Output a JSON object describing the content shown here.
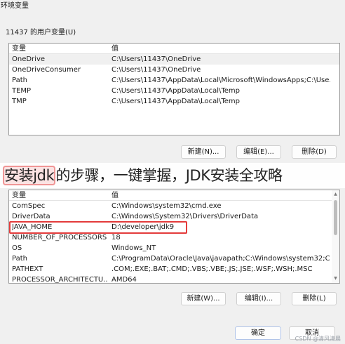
{
  "window": {
    "title": "环境变量"
  },
  "user_vars": {
    "label": "11437 的用户变量(U)",
    "columns": [
      "变量",
      "值"
    ],
    "rows": [
      [
        "OneDrive",
        "C:\\Users\\11437\\OneDrive"
      ],
      [
        "OneDriveConsumer",
        "C:\\Users\\11437\\OneDrive"
      ],
      [
        "Path",
        "C:\\Users\\11437\\AppData\\Local\\Microsoft\\WindowsApps;C:\\Use..."
      ],
      [
        "TEMP",
        "C:\\Users\\11437\\AppData\\Local\\Temp"
      ],
      [
        "TMP",
        "C:\\Users\\11437\\AppData\\Local\\Temp"
      ]
    ],
    "buttons": {
      "new": "新建(N)...",
      "edit": "编辑(E)...",
      "delete": "删除(D)"
    }
  },
  "system_vars": {
    "columns": [
      "变量",
      "值"
    ],
    "rows": [
      [
        "ComSpec",
        "C:\\Windows\\system32\\cmd.exe"
      ],
      [
        "DriverData",
        "C:\\Windows\\System32\\Drivers\\DriverData"
      ],
      [
        "JAVA_HOME",
        "D:\\developer\\jdk9"
      ],
      [
        "NUMBER_OF_PROCESSORS",
        "18"
      ],
      [
        "OS",
        "Windows_NT"
      ],
      [
        "Path",
        "C:\\ProgramData\\Oracle\\Java\\javapath;C:\\Windows\\system32;C:..."
      ],
      [
        "PATHEXT",
        ".COM;.EXE;.BAT;.CMD;.VBS;.VBE;.JS;.JSE;.WSF;.WSH;.MSC"
      ],
      [
        "PROCESSOR_ARCHITECTU...",
        "AMD64"
      ]
    ],
    "buttons": {
      "new": "新建(W)...",
      "edit": "编辑(I)...",
      "delete": "删除(L)"
    }
  },
  "footer": {
    "ok": "确定",
    "cancel": "取消"
  },
  "overlay": {
    "highlight": "安装jdk",
    "rest": "的步骤，一键掌握，JDK安装全攻略"
  },
  "watermark": "CSDN @清风清晨",
  "colors": {
    "background": "#f0f0f0",
    "highlight_border": "#e33b3b",
    "overlay_mark": "#f09696"
  }
}
